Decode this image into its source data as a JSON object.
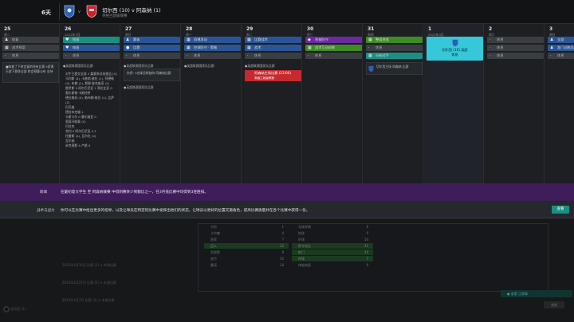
{
  "header": {
    "days_label": "6天",
    "vs": "v",
    "match_title": "切尔西 (10) v 阿森纳 (1)",
    "match_subtitle": "英格兰超级联赛"
  },
  "calendar": {
    "days": [
      {
        "num": "25",
        "sub": "周二"
      },
      {
        "num": "26",
        "sub": "2022年3月"
      },
      {
        "num": "27",
        "sub": "周日"
      },
      {
        "num": "28",
        "sub": "周一"
      },
      {
        "num": "29",
        "sub": "周二"
      },
      {
        "num": "30",
        "sub": "周三"
      },
      {
        "num": "31",
        "sub": "周四"
      },
      {
        "num": "1",
        "sub": "2022年4月"
      },
      {
        "num": "2",
        "sub": "周六"
      },
      {
        "num": "3",
        "sub": "周日"
      }
    ],
    "col0": {
      "s1": "恢复",
      "s2": "战术预案",
      "s3": "休息",
      "card": "■恢复了下转会窗的所有比赛 5家俱乐部下赛季全部 转会预算公布 支持"
    },
    "col1": {
      "s1": "恢复",
      "s2": "恢复",
      "s3": "休息",
      "event": "●英超联赛国家队比赛",
      "text": [
        "对手已提交全部 3 篇赛季总结报告 [0]",
        "马利斯 (4), 卡普斯·维拉 (1), 阿德勒 (0), 布朗 (2), 斯穆·鲁克维奇 (3)",
        "俄罗斯 0 阿尔巴尼亚 1 哥伦比亚 0",
        "奥尔斯顿·卡斯特罗",
        "德拉格苏 (0), 勒布朗·格伦 (1), 比萨 (2)",
        "巴巴维",
        "德拉布克福 1",
        "卡斯卡尔 0 塞尔维亚 0",
        "葡萄牙联赛 (0)",
        "巴拉克",
        "克利 0 阿尔巴尼亚 4 2",
        "托雷斯 (4), 瓦尔杜 (4)",
        "瓦尔纳",
        "米克莱斯 4 卢斯 0"
      ]
    },
    "col2": {
      "s1": "赛体",
      "s2": "比赛",
      "s3": "休息",
      "event": "●英超联赛国家队比赛",
      "card": "伤停: 3名球员将缺阵 阿森纳比赛",
      "event2": "●英超联赛国家队比赛"
    },
    "col3": {
      "s1": "恐惧发动",
      "s2": "控球防守 · 策略",
      "s3": "休息",
      "event": "●英超联赛国家队比赛"
    },
    "col4": {
      "s1": "比赛战术",
      "s2": "战术",
      "s3": "休息",
      "event": "●英超联赛国家队比赛",
      "red": "阿森纳主场比赛 (23:00)",
      "red2": "英格兰超级联赛"
    },
    "col5": {
      "s1": "积极防守",
      "s2": "战术互动训练",
      "s3": "休息"
    },
    "col6": {
      "s1": "整组进攻",
      "s2": "休息",
      "s3": "分析对手",
      "card": "切尔西主场 阿森纳 比赛"
    },
    "col7": {
      "match": "切尔西 (10) 英超",
      "sub": "休息"
    },
    "col8": {
      "s1": "休息",
      "s2": "休息",
      "s3": "休息"
    },
    "col9": {
      "s1": "全部",
      "s2": "准门训练员",
      "s3": "休息"
    }
  },
  "banner": {
    "label": "新闻",
    "message": "在最初意大学生 至 阿森纳联赛 中得到赛季少到额比之一，在3月低比赛中均得到3连胜排。"
  },
  "advice": {
    "label": "战术与战力",
    "message": "你可以在比赛中给出更多的指导，以及让球员在特定的比赛中发挥出他们的状态，让球员以更好的位置实施角色，提高比赛质量并在各个比赛中获得一份。",
    "button": "查看"
  },
  "lower": {
    "ghost1": "2022年3月16日 比赛 (1) ⊙ 本周比赛",
    "ghost2": "2022年3月21日 比赛 (2) ⊙ 本周比赛",
    "ghost3": "2022年3月7日 比赛 (3) ⊙ 本周比赛",
    "rows_left": [
      {
        "name": "分析",
        "n": "1"
      },
      {
        "name": "卡尔森",
        "n": "4"
      },
      {
        "name": "皇家",
        "n": "7"
      },
      {
        "name": "迈入",
        "n": "12"
      },
      {
        "name": "凯恩斯",
        "n": "8"
      },
      {
        "name": "皮尔",
        "n": "10"
      },
      {
        "name": "雷诺",
        "n": "14"
      }
    ],
    "rows_mid": [
      {
        "name": "无球奔跑",
        "n": "8"
      },
      {
        "name": "控球",
        "n": "9"
      },
      {
        "name": "铲球",
        "n": "10"
      },
      {
        "name": "防守站位",
        "n": "11"
      },
      {
        "name": "射门",
        "n": "14"
      },
      {
        "name": "传球",
        "n": "7"
      },
      {
        "name": "体能恢复",
        "n": "9"
      }
    ],
    "pill": "● 查看 正赛事",
    "pill2": "关闭",
    "bottom_left": "切尔西 (1)"
  }
}
